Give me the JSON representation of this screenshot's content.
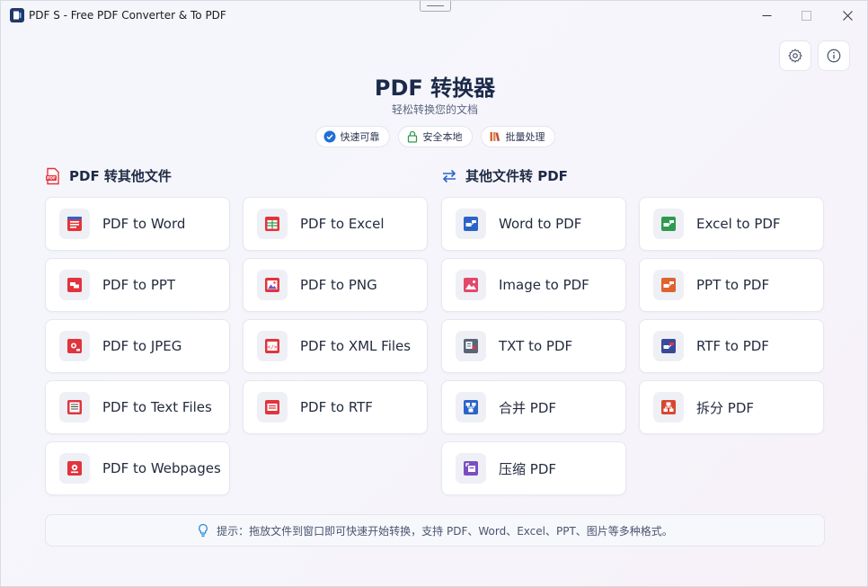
{
  "window": {
    "title": "PDF S - Free PDF Converter & To PDF"
  },
  "header": {
    "title": "PDF 转换器",
    "subtitle": "轻松转换您的文档",
    "features": [
      {
        "label": "快速可靠",
        "icon": "check-circle-icon",
        "color": "#1f6fd6"
      },
      {
        "label": "安全本地",
        "icon": "lock-icon",
        "color": "#2f9a4a"
      },
      {
        "label": "批量处理",
        "icon": "books-icon",
        "color": "#d4683a"
      }
    ]
  },
  "sections": {
    "left": {
      "title": "PDF 转其他文件",
      "icon": "pdf-file-icon",
      "cards": [
        {
          "label": "PDF to Word",
          "icon": "word-doc-icon",
          "color": "#e2343c"
        },
        {
          "label": "PDF to Excel",
          "icon": "excel-sheet-icon",
          "color": "#e2343c"
        },
        {
          "label": "PDF to PPT",
          "icon": "ppt-slides-icon",
          "color": "#e2343c"
        },
        {
          "label": "PDF to PNG",
          "icon": "png-image-icon",
          "color": "#e2343c"
        },
        {
          "label": "PDF to JPEG",
          "icon": "jpeg-camera-icon",
          "color": "#e2343c"
        },
        {
          "label": "PDF to XML Files",
          "icon": "xml-code-icon",
          "color": "#e2343c"
        },
        {
          "label": "PDF to Text Files",
          "icon": "text-lines-icon",
          "color": "#e2343c"
        },
        {
          "label": "PDF to RTF",
          "icon": "rtf-doc-icon",
          "color": "#e2343c"
        },
        {
          "label": "PDF to Webpages",
          "icon": "webpage-globe-icon",
          "color": "#e2343c"
        }
      ]
    },
    "right": {
      "title": "其他文件转 PDF",
      "icon": "swap-arrows-icon",
      "cards": [
        {
          "label": "Word to PDF",
          "icon": "word-to-pdf-icon",
          "color": "#2b64c9"
        },
        {
          "label": "Excel to PDF",
          "icon": "excel-to-pdf-icon",
          "color": "#2e9b4f"
        },
        {
          "label": "Image to PDF",
          "icon": "image-to-pdf-icon",
          "color": "#e2486a"
        },
        {
          "label": "PPT to PDF",
          "icon": "ppt-to-pdf-icon",
          "color": "#e0622e"
        },
        {
          "label": "TXT to PDF",
          "icon": "txt-to-pdf-icon",
          "color": "#5a6578"
        },
        {
          "label": "RTF to PDF",
          "icon": "rtf-to-pdf-icon",
          "color": "#3a4a9a"
        },
        {
          "label": "合并 PDF",
          "icon": "merge-pdf-icon",
          "color": "#2b64c9"
        },
        {
          "label": "拆分 PDF",
          "icon": "split-pdf-icon",
          "color": "#d9472f"
        },
        {
          "label": "压缩 PDF",
          "icon": "compress-pdf-icon",
          "color": "#7a4fc2"
        }
      ]
    }
  },
  "tip": {
    "text": "提示：拖放文件到窗口即可快速开始转换，支持 PDF、Word、Excel、PPT、图片等多种格式。",
    "icon": "lightbulb-icon"
  }
}
